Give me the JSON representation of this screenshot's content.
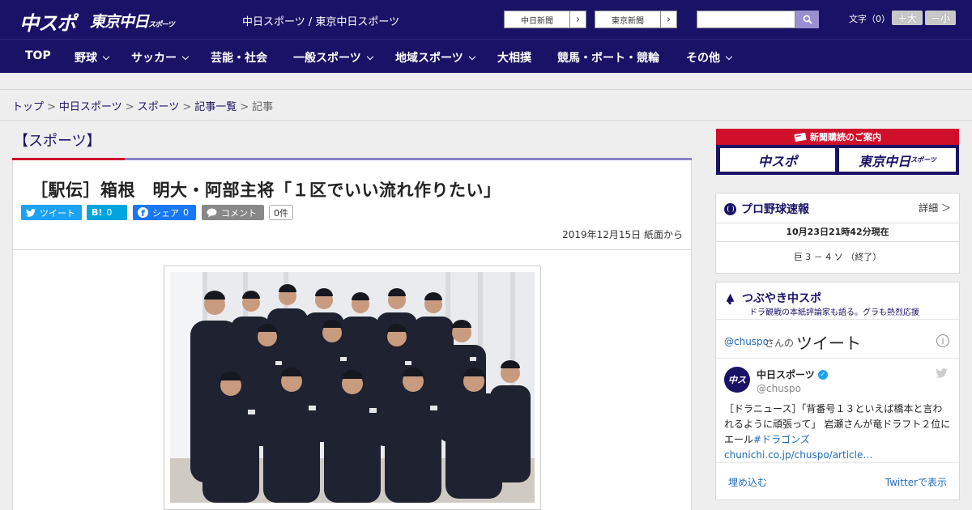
{
  "header": {
    "logo_main": "中スポ",
    "logo_tokyo": "東京中日",
    "logo_tokyo_sub": "スポーツ",
    "site_title": "中日スポーツ / 東京中日スポーツ",
    "ext_links": [
      {
        "label": "中日新聞"
      },
      {
        "label": "東京新聞"
      }
    ],
    "search_placeholder": "",
    "font_size_label": "文字（0）",
    "font_bigger": "＋大",
    "font_smaller": "－小"
  },
  "nav": {
    "items": [
      {
        "label": "TOP",
        "has_menu": false
      },
      {
        "label": "野球",
        "has_menu": true
      },
      {
        "label": "サッカー",
        "has_menu": true
      },
      {
        "label": "芸能・社会",
        "has_menu": false
      },
      {
        "label": "一般スポーツ",
        "has_menu": true
      },
      {
        "label": "地域スポーツ",
        "has_menu": true
      },
      {
        "label": "大相撲",
        "has_menu": false
      },
      {
        "label": "競馬・ボート・競輪",
        "has_menu": false
      },
      {
        "label": "その他",
        "has_menu": true
      }
    ]
  },
  "breadcrumb": {
    "items": [
      "トップ",
      "中日スポーツ",
      "スポーツ",
      "記事一覧"
    ],
    "current": "記事",
    "separator": ">"
  },
  "article": {
    "category": "【スポーツ】",
    "headline": "［駅伝］箱根　明大・阿部主将「１区でいい流れ作りたい」",
    "share": {
      "tweet": "ツイート",
      "hatena": "B!",
      "hatena_count": "0",
      "facebook": "シェア",
      "facebook_count": "0",
      "comment": "コメント",
      "comment_count": "0件"
    },
    "date": "2019年12月15日 紙面から"
  },
  "sidebar": {
    "subscribe": {
      "title": "新聞購読のご案内",
      "btn_chuspo": "中スポ",
      "btn_tokyo": "東京中日",
      "btn_tokyo_sub": "スポーツ"
    },
    "baseball": {
      "title": "プロ野球速報",
      "detail": "詳細 ＞",
      "updated": "10月23日21時42分現在",
      "score": "巨 3 － 4 ソ （終了）"
    },
    "tsubuyaki": {
      "title": "つぶやき中スポ",
      "subtitle": "ドラ観戦の本紙評論家も語る。グラも熱烈応援",
      "handle_link": "@chuspo",
      "handle_suffix": "さんの",
      "tweet_word": "ツイート",
      "account_name": "中日スポーツ",
      "account_handle": "@chuspo",
      "tweet_text": "［ドラニュース］「背番号１３といえば橋本と言われるように頑張って」 岩瀬さんが竜ドラフト２位にエール",
      "hashtag": "#ドラゴンズ",
      "link": "chunichi.co.jp/chuspo/article…",
      "embed": "埋め込む",
      "view_on_twitter": "Twitterで表示"
    }
  },
  "colors": {
    "brand_navy": "#1a1266",
    "brand_red": "#d0102b",
    "twitter_blue": "#1da1f2",
    "hatena_blue": "#00a4de",
    "facebook_blue": "#1877f2"
  }
}
